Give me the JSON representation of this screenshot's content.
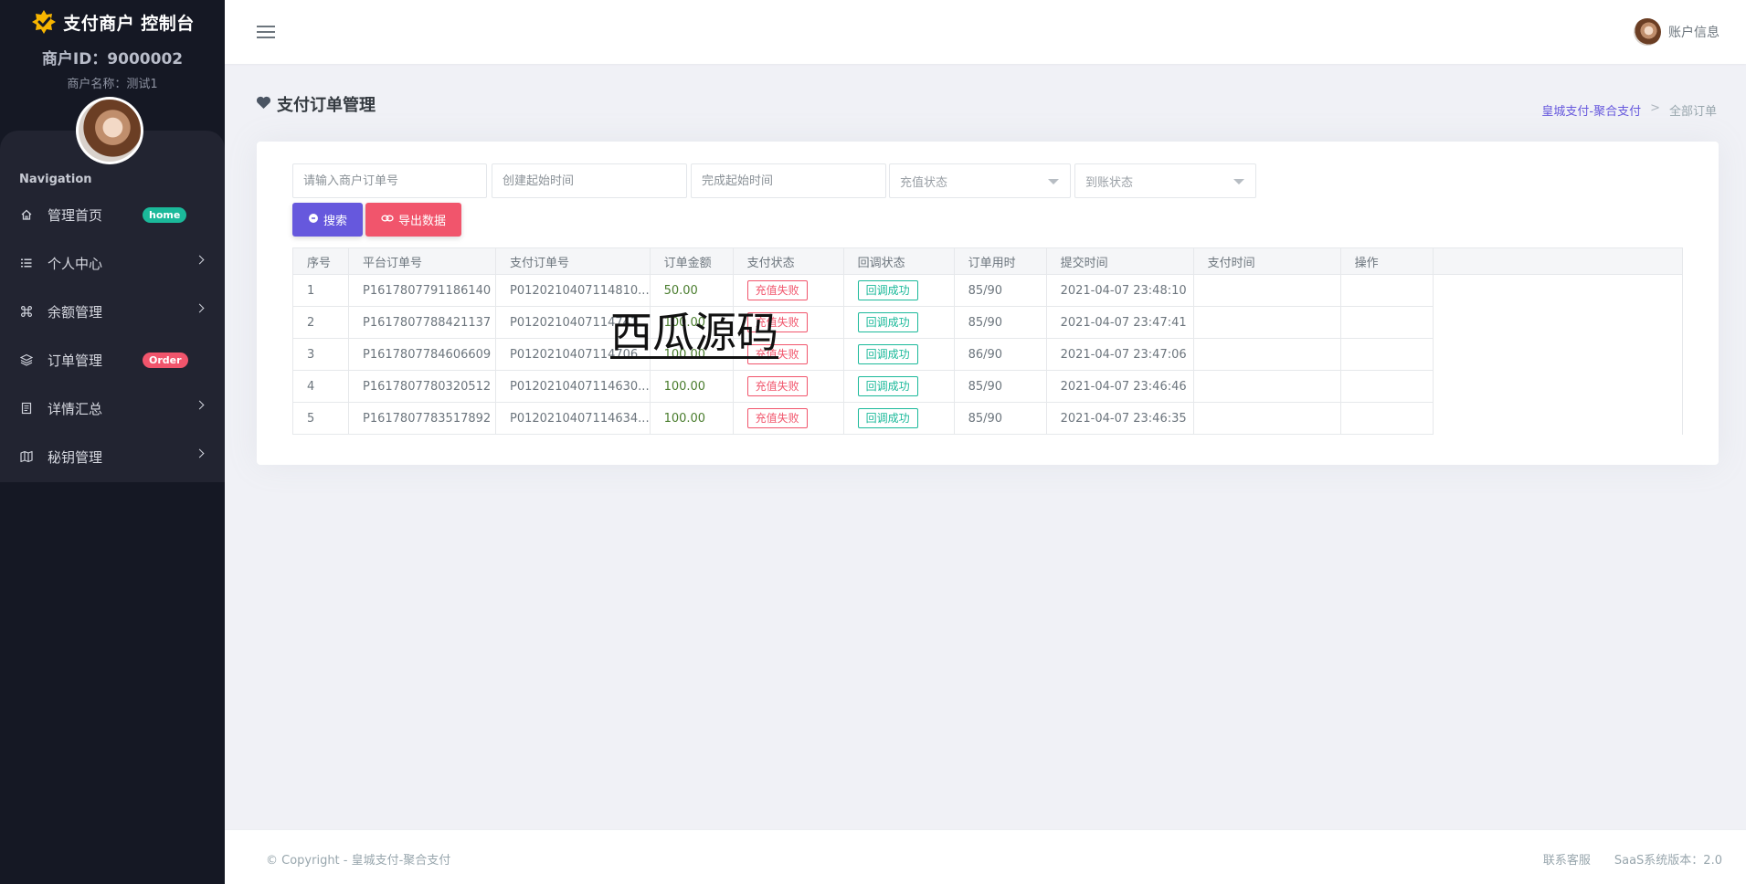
{
  "sidebar": {
    "brand": "支付商户 控制台",
    "merchant_id": "商户ID：9000002",
    "merchant_name": "商户名称：测试1",
    "nav_title": "Navigation",
    "items": [
      {
        "label": "管理首页",
        "icon": "home-icon",
        "badge": "home"
      },
      {
        "label": "个人中心",
        "icon": "list-icon"
      },
      {
        "label": "余额管理",
        "icon": "command-icon"
      },
      {
        "label": "订单管理",
        "icon": "layers-icon",
        "badge": "Order"
      },
      {
        "label": "详情汇总",
        "icon": "document-icon"
      },
      {
        "label": "秘钥管理",
        "icon": "map-icon"
      }
    ]
  },
  "topbar": {
    "account_label": "账户信息"
  },
  "page": {
    "title": "支付订单管理",
    "breadcrumb": {
      "link": "皇城支付-聚合支付",
      "separator": ">",
      "current": "全部订单"
    }
  },
  "filters": {
    "order_no_placeholder": "请输入商户订单号",
    "create_time_placeholder": "创建起始时间",
    "finish_time_placeholder": "完成起始时间",
    "recharge_status": "充值状态",
    "arrival_status": "到账状态",
    "search_button": "搜索",
    "export_button": "导出数据"
  },
  "table": {
    "headers": [
      "序号",
      "平台订单号",
      "支付订单号",
      "订单金额",
      "支付状态",
      "回调状态",
      "订单用时",
      "提交时间",
      "支付时间",
      "操作"
    ],
    "rows": [
      {
        "idx": "1",
        "platform_no": "P1617807791186140",
        "pay_no": "P0120210407114810...",
        "amount": "50.00",
        "pay_status": "充值失败",
        "callback": "回调成功",
        "duration": "85/90",
        "submit_time": "2021-04-07 23:48:10",
        "pay_time": "",
        "ops": ""
      },
      {
        "idx": "2",
        "platform_no": "P1617807788421137",
        "pay_no": "P0120210407114741...",
        "amount": "100.00",
        "pay_status": "充值失败",
        "callback": "回调成功",
        "duration": "85/90",
        "submit_time": "2021-04-07 23:47:41",
        "pay_time": "",
        "ops": ""
      },
      {
        "idx": "3",
        "platform_no": "P1617807784606609",
        "pay_no": "P0120210407114706...",
        "amount": "100.00",
        "pay_status": "充值失败",
        "callback": "回调成功",
        "duration": "86/90",
        "submit_time": "2021-04-07 23:47:06",
        "pay_time": "",
        "ops": ""
      },
      {
        "idx": "4",
        "platform_no": "P1617807780320512",
        "pay_no": "P0120210407114630...",
        "amount": "100.00",
        "pay_status": "充值失败",
        "callback": "回调成功",
        "duration": "85/90",
        "submit_time": "2021-04-07 23:46:46",
        "pay_time": "",
        "ops": ""
      },
      {
        "idx": "5",
        "platform_no": "P1617807783517892",
        "pay_no": "P0120210407114634...",
        "amount": "100.00",
        "pay_status": "充值失败",
        "callback": "回调成功",
        "duration": "85/90",
        "submit_time": "2021-04-07 23:46:35",
        "pay_time": "",
        "ops": ""
      }
    ]
  },
  "watermark": "西瓜源码",
  "footer": {
    "copyright": "© Copyright - 皇城支付-聚合支付",
    "contact": "联系客服",
    "version": "SaaS系统版本：2.0"
  },
  "colors": {
    "sidebar_bg": "#151824",
    "accent_purple": "#6658dd",
    "accent_pink": "#f1556c",
    "accent_green": "#1bb99a"
  }
}
